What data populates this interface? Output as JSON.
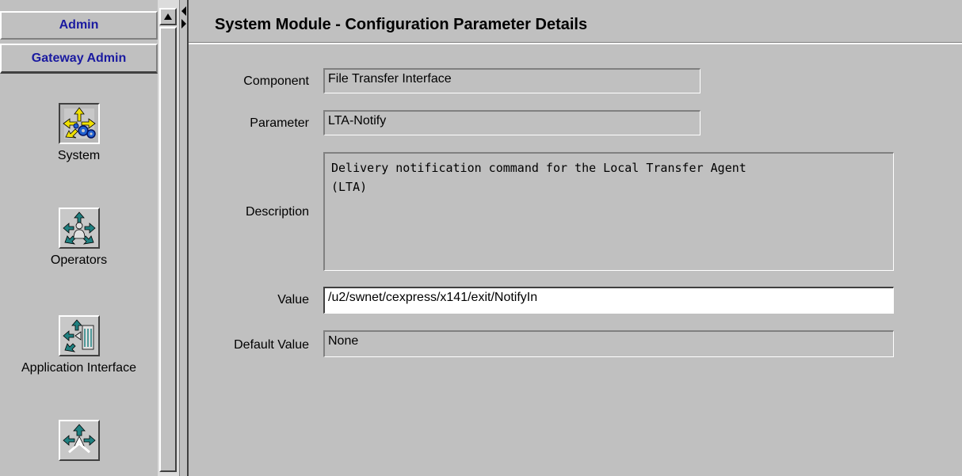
{
  "nav": {
    "header_admin": "Admin",
    "header_gateway": "Gateway Admin",
    "modules": [
      {
        "label": "System",
        "icon": "system-config-icon",
        "selected": true
      },
      {
        "label": "Operators",
        "icon": "operators-icon",
        "selected": false
      },
      {
        "label": "Application Interface",
        "icon": "application-interface-icon",
        "selected": false
      },
      {
        "label": "",
        "icon": "network-module-icon",
        "selected": false
      }
    ]
  },
  "main": {
    "title": "System Module - Configuration Parameter Details",
    "fields": {
      "component_label": "Component",
      "component_value": "File Transfer Interface",
      "parameter_label": "Parameter",
      "parameter_value": "LTA-Notify",
      "description_label": "Description",
      "description_value": "Delivery notification command for the Local Transfer Agent\n(LTA)",
      "value_label": "Value",
      "value_value": "/u2/swnet/cexpress/x141/exit/NotifyIn",
      "default_label": "Default Value",
      "default_value": "None"
    }
  },
  "colors": {
    "background": "#c0c0c0",
    "header_text": "#1a1aa0",
    "accent_yellow": "#f0e000",
    "accent_blue": "#2060d0",
    "accent_teal": "#208080"
  }
}
